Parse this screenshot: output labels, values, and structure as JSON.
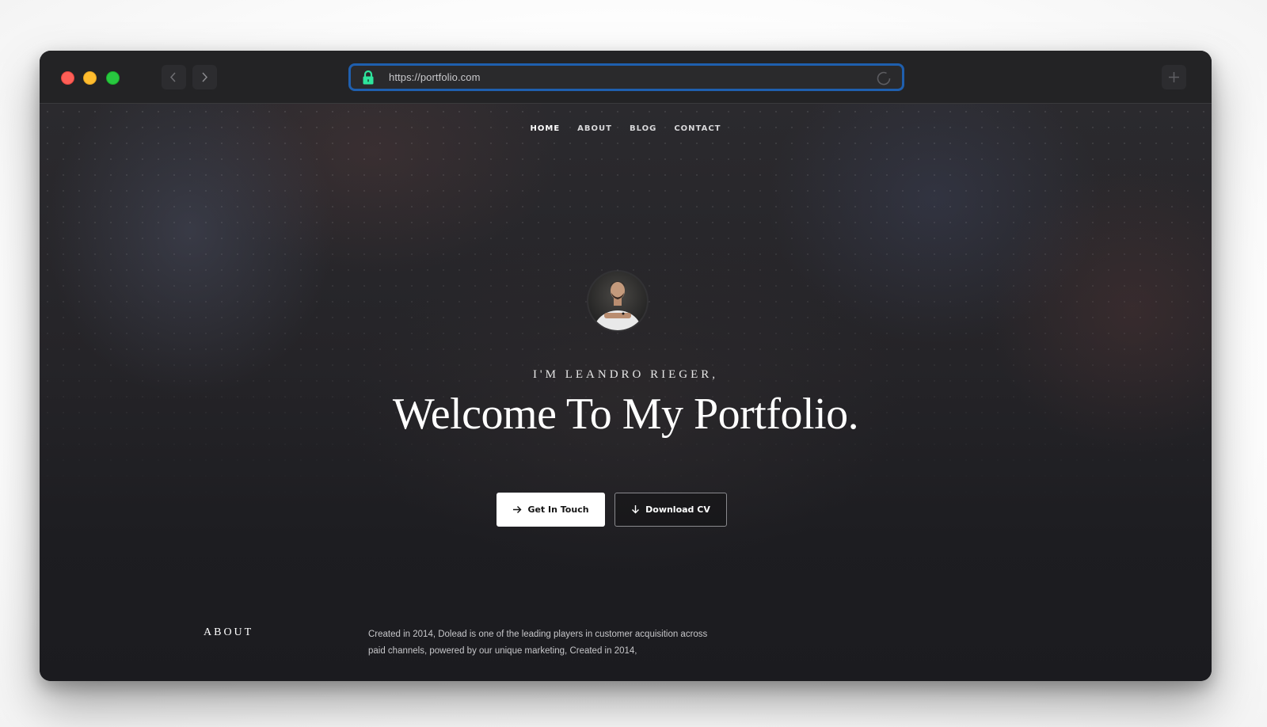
{
  "browser": {
    "url": "https://portfolio.com",
    "traffic_lights": {
      "close": "#fe5f57",
      "minimize": "#febc2e",
      "zoom": "#28c840"
    },
    "url_focus_color": "#1f5fae",
    "lock_color": "#2ee59d"
  },
  "nav": {
    "items": [
      {
        "label": "HOME",
        "active": true
      },
      {
        "label": "ABOUT",
        "active": false
      },
      {
        "label": "BLOG",
        "active": false
      },
      {
        "label": "CONTACT",
        "active": false
      }
    ]
  },
  "hero": {
    "intro": "I'M LEANDRO RIEGER,",
    "headline": "Welcome To My Portfolio.",
    "buttons": {
      "primary": {
        "label": "Get In Touch",
        "icon": "arrow-right-icon"
      },
      "secondary": {
        "label": "Download CV",
        "icon": "arrow-down-icon"
      }
    }
  },
  "about": {
    "title": "ABOUT",
    "text": "Created in 2014, Dolead is one of the leading players in customer acquisition across paid channels, powered by our unique marketing, Created in 2014,"
  }
}
